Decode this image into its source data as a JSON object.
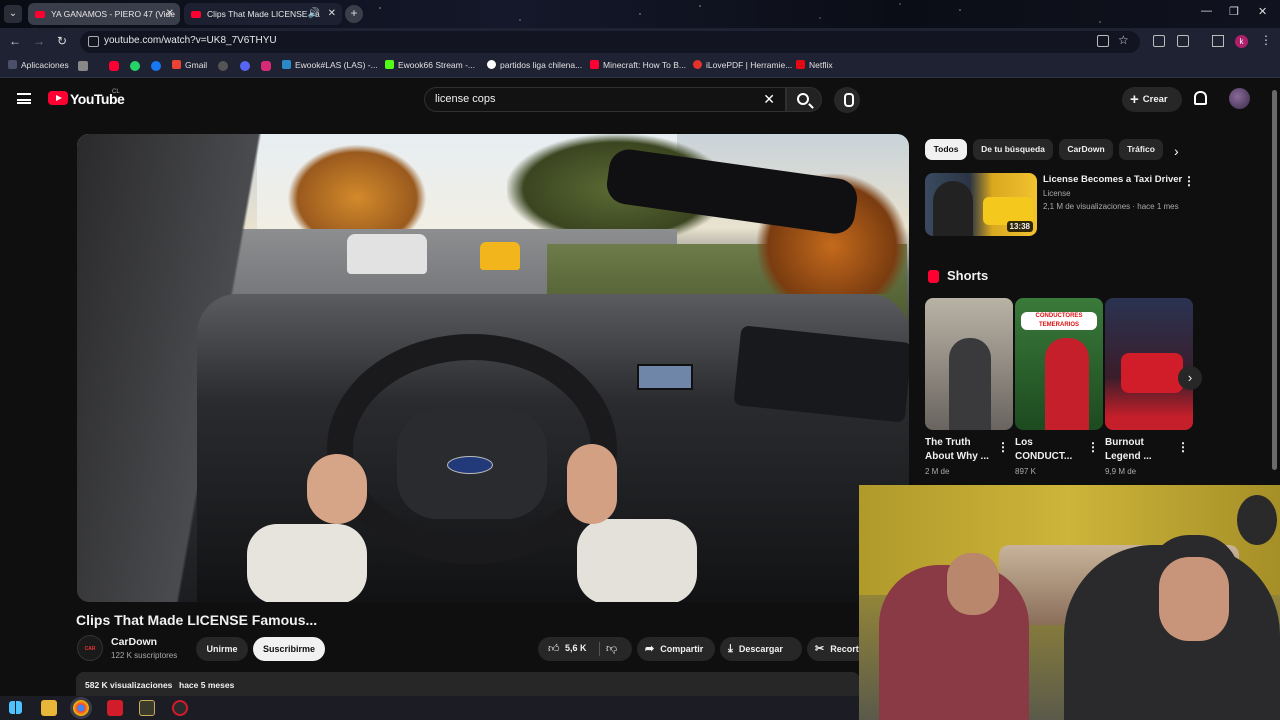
{
  "browser": {
    "tabs": [
      {
        "title": "YA GANAMOS - PIERO 47 (Vide",
        "active": true
      },
      {
        "title": "Clips That Made LICENSE Fa",
        "active": false
      }
    ],
    "url": "youtube.com/watch?v=UK8_7V6THYU",
    "profile_initial": "k",
    "bookmarks": [
      {
        "label": "Aplicaciones"
      },
      {
        "label": "Gmail"
      },
      {
        "label": "Ewook#LAS (LAS) -..."
      },
      {
        "label": "Ewook66 Stream -..."
      },
      {
        "label": "partidos liga chilena..."
      },
      {
        "label": "Minecraft: How To B..."
      },
      {
        "label": "iLovePDF | Herramie..."
      },
      {
        "label": "Netflix"
      }
    ]
  },
  "youtube": {
    "logo_text": "YouTube",
    "country_code": "CL",
    "search_query": "license cops",
    "create_label": "Crear",
    "video": {
      "title": "Clips That Made LICENSE Famous...",
      "channel": "CarDown",
      "channel_avatar_text": "CAR DOWN",
      "subscribers": "122 K suscriptores",
      "join_label": "Unirme",
      "subscribe_label": "Suscribirme",
      "likes": "5,6 K",
      "share_label": "Compartir",
      "download_label": "Descargar",
      "clip_label": "Recortar",
      "views": "582 K visualizaciones",
      "age": "hace 5 meses"
    },
    "filter_chips": [
      "Todos",
      "De tu búsqueda",
      "CarDown",
      "Tráfico"
    ],
    "recommended": {
      "title": "License Becomes a Taxi Driver",
      "channel": "License",
      "meta": "2,1 M de visualizaciones · hace 1 mes",
      "duration": "13:38"
    },
    "shorts_header": "Shorts",
    "shorts": [
      {
        "title": "The Truth About Why ...",
        "meta": "2 M de"
      },
      {
        "title": "Los CONDUCT...",
        "meta": "897 K",
        "banner": "CONDUCTORES TEMERARIOS"
      },
      {
        "title": "Burnout Legend ...",
        "meta": "9,9 M de"
      }
    ]
  }
}
